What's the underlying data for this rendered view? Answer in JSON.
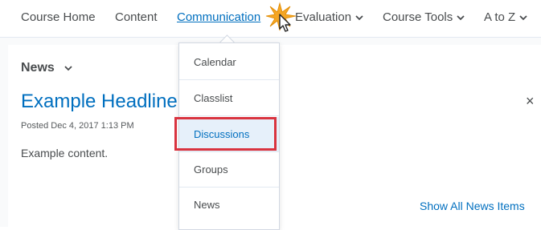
{
  "nav": {
    "items": [
      {
        "label": "Course Home",
        "has_chevron": false
      },
      {
        "label": "Content",
        "has_chevron": false
      },
      {
        "label": "Communication",
        "has_chevron": true,
        "active": true
      },
      {
        "label": "Evaluation",
        "has_chevron": true
      },
      {
        "label": "Course Tools",
        "has_chevron": true
      },
      {
        "label": "A to Z",
        "has_chevron": true
      }
    ]
  },
  "dropdown": {
    "items": [
      {
        "label": "Calendar"
      },
      {
        "label": "Classlist"
      },
      {
        "label": "Discussions",
        "selected": true
      },
      {
        "label": "Groups"
      },
      {
        "label": "News"
      }
    ]
  },
  "widget": {
    "title": "News",
    "headline": "Example Headline",
    "posted": "Posted Dec 4, 2017 1:13 PM",
    "body": "Example content.",
    "close_glyph": "×",
    "show_all": "Show All News Items"
  },
  "colors": {
    "accent": "#006fbf",
    "text": "#494c4e",
    "highlight": "#d9333f",
    "cursor_burst": "#f5a623"
  },
  "icons": {
    "chevron": "chevron-down-icon",
    "close": "close-icon",
    "cursor": "mouse-pointer-icon"
  }
}
